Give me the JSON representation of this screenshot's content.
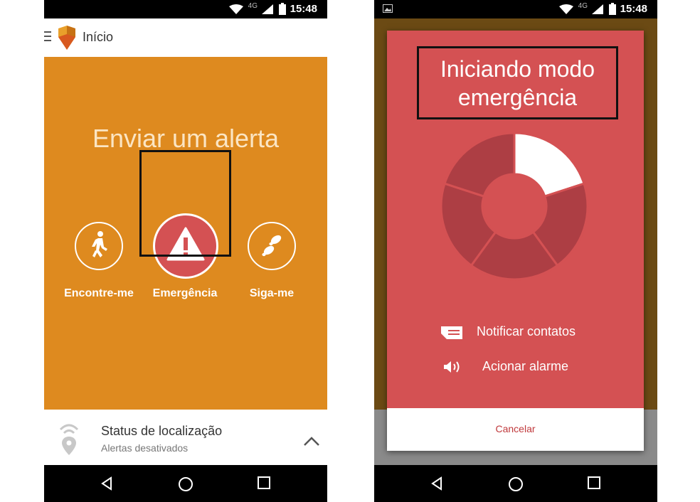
{
  "status_bar": {
    "time": "15:48",
    "network": "4G"
  },
  "left_screen": {
    "app_bar": {
      "title": "Início"
    },
    "alert_title": "Enviar um alerta",
    "options": [
      {
        "label": "Encontre-me",
        "icon": "walking-person-icon"
      },
      {
        "label": "Emergência",
        "icon": "warning-icon"
      },
      {
        "label": "Siga-me",
        "icon": "footprints-icon"
      }
    ],
    "location_panel": {
      "title": "Status de localização",
      "subtitle": "Alertas desativados"
    }
  },
  "right_screen": {
    "dialog": {
      "title_line1": "Iniciando modo",
      "title_line2": "emergência",
      "countdown_segments": 5,
      "countdown_filled": 1,
      "actions": [
        {
          "label": "Notificar contatos",
          "icon": "message-icon"
        },
        {
          "label": "Acionar alarme",
          "icon": "speaker-icon"
        }
      ],
      "cancel_label": "Cancelar"
    }
  },
  "colors": {
    "orange": "#de8a1f",
    "emergency_red": "#d45153",
    "donut_dark": "#ad3e44",
    "donut_filled": "#ffffff"
  }
}
